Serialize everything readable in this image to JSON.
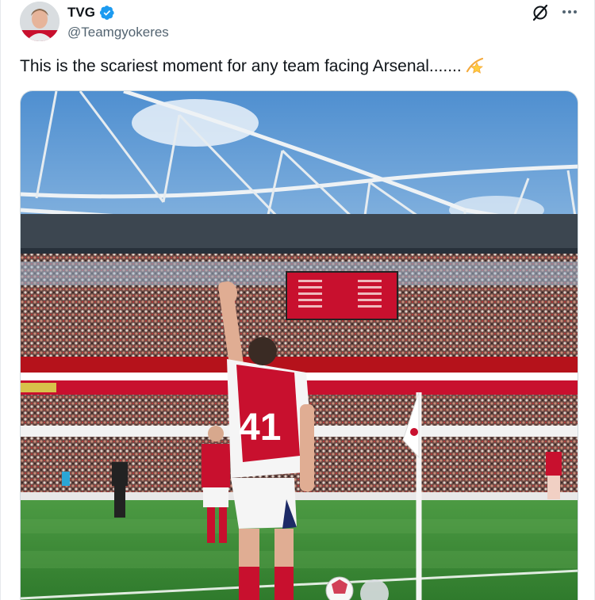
{
  "author": {
    "display_name": "TVG",
    "handle": "@Teamgyokeres",
    "verified": true,
    "verified_color": "#1d9bf0"
  },
  "actions": {
    "grok_icon": "grok-icon",
    "more_icon": "more-options-icon"
  },
  "tweet": {
    "text": "This is the scariest moment for any team facing Arsenal.......",
    "emoji": "dizzy-star-emoji"
  },
  "media": {
    "kind": "photo",
    "description_icons": [
      "stadium",
      "player-41",
      "corner-flag",
      "football"
    ],
    "shirt_number": "41",
    "scoreboard_color": "#c8102e",
    "pitch_color": "#3f8f3a",
    "sky_color": "#6ea6dc"
  }
}
